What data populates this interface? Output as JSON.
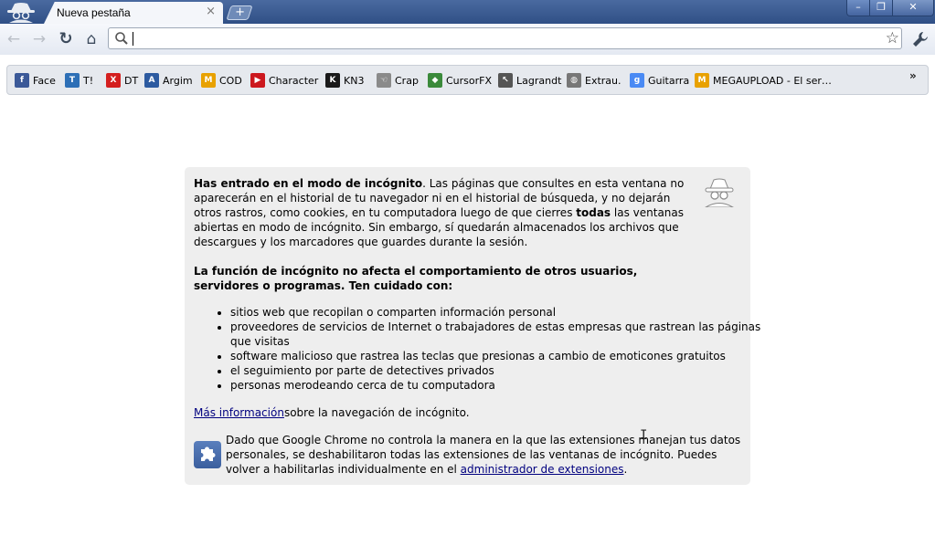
{
  "window": {
    "tab_title": "Nueva pestaña",
    "tab_close_glyph": "×",
    "new_tab_glyph": "+",
    "minimize_glyph": "–",
    "maximize_glyph": "❐",
    "close_glyph": "✕"
  },
  "toolbar": {
    "back_icon": "back-arrow-icon",
    "forward_icon": "forward-arrow-icon",
    "reload_glyph": "↻",
    "home_glyph": "⌂",
    "back_glyph": "←",
    "forward_glyph": "→",
    "omnibox_value": "",
    "star_glyph": "☆"
  },
  "bookmarks": [
    {
      "label": "Face",
      "icon": "facebook-icon",
      "glyph": "f",
      "color": "#3b5998"
    },
    {
      "label": "T!",
      "icon": "taringa-icon",
      "glyph": "T",
      "color": "#2d6fb6"
    },
    {
      "label": "DT",
      "icon": "dt-icon",
      "glyph": "X",
      "color": "#d41f1f"
    },
    {
      "label": "Argim",
      "icon": "argim-icon",
      "glyph": "A",
      "color": "#2c5aa0"
    },
    {
      "label": "COD",
      "icon": "megaupload-icon",
      "glyph": "M",
      "color": "#e8a100"
    },
    {
      "label": "Character",
      "icon": "youtube-icon",
      "glyph": "▶",
      "color": "#cc181e"
    },
    {
      "label": "KN3",
      "icon": "kn3-icon",
      "glyph": "K",
      "color": "#1a1a1a"
    },
    {
      "label": "Crap",
      "icon": "hand-icon",
      "glyph": "☜",
      "color": "#8a8a8a"
    },
    {
      "label": "CursorFX",
      "icon": "cursorfx-icon",
      "glyph": "◆",
      "color": "#3b8a3b"
    },
    {
      "label": "Lagrandt",
      "icon": "pointer-icon",
      "glyph": "↖",
      "color": "#555555"
    },
    {
      "label": "Extrau.",
      "icon": "globe-icon",
      "glyph": "◍",
      "color": "#777777"
    },
    {
      "label": "Guitarra",
      "icon": "google-icon",
      "glyph": "g",
      "color": "#4a8af4"
    },
    {
      "label": "MEGAUPLOAD - El ser…",
      "icon": "megaupload-icon",
      "glyph": "M",
      "color": "#e8a100"
    }
  ],
  "bookmarks_overflow": "»",
  "incognito": {
    "p1_bold": "Has entrado en el modo de incógnito",
    "p1_text": ". Las páginas que consultes en esta ventana no aparecerán en el historial de tu navegador ni en el historial de búsqueda, y no dejarán otros rastros, como cookies, en tu computadora luego de que cierres ",
    "p1_bold2": "todas",
    "p1_text2": " las ventanas abiertas en modo de incógnito. Sin embargo, sí quedarán almacenados los archivos que descargues y los marcadores que guardes durante la sesión.",
    "p2": "La función de incógnito no afecta el comportamiento de otros usuarios, servidores o programas. Ten cuidado con:",
    "risks": [
      "sitios web que recopilan o comparten información personal",
      "proveedores de servicios de Internet o trabajadores de estas empresas que rastrean las páginas que visitas",
      "software malicioso que rastrea las teclas que presionas a cambio de emoticones gratuitos",
      "el seguimiento por parte de detectives privados",
      "personas merodeando cerca de tu computadora"
    ],
    "more_info_link": "Más información",
    "more_info_text": "sobre la navegación de incógnito.",
    "ext_text": "Dado que Google Chrome no controla la manera en la que las extensiones manejan tus datos personales, se deshabilitaron todas las extensiones de las ventanas de incógnito. Puedes volver a habilitarlas individualmente en el ",
    "ext_link": "administrador de extensiones",
    "ext_end": "."
  },
  "mouse_cursor_glyph": "I"
}
